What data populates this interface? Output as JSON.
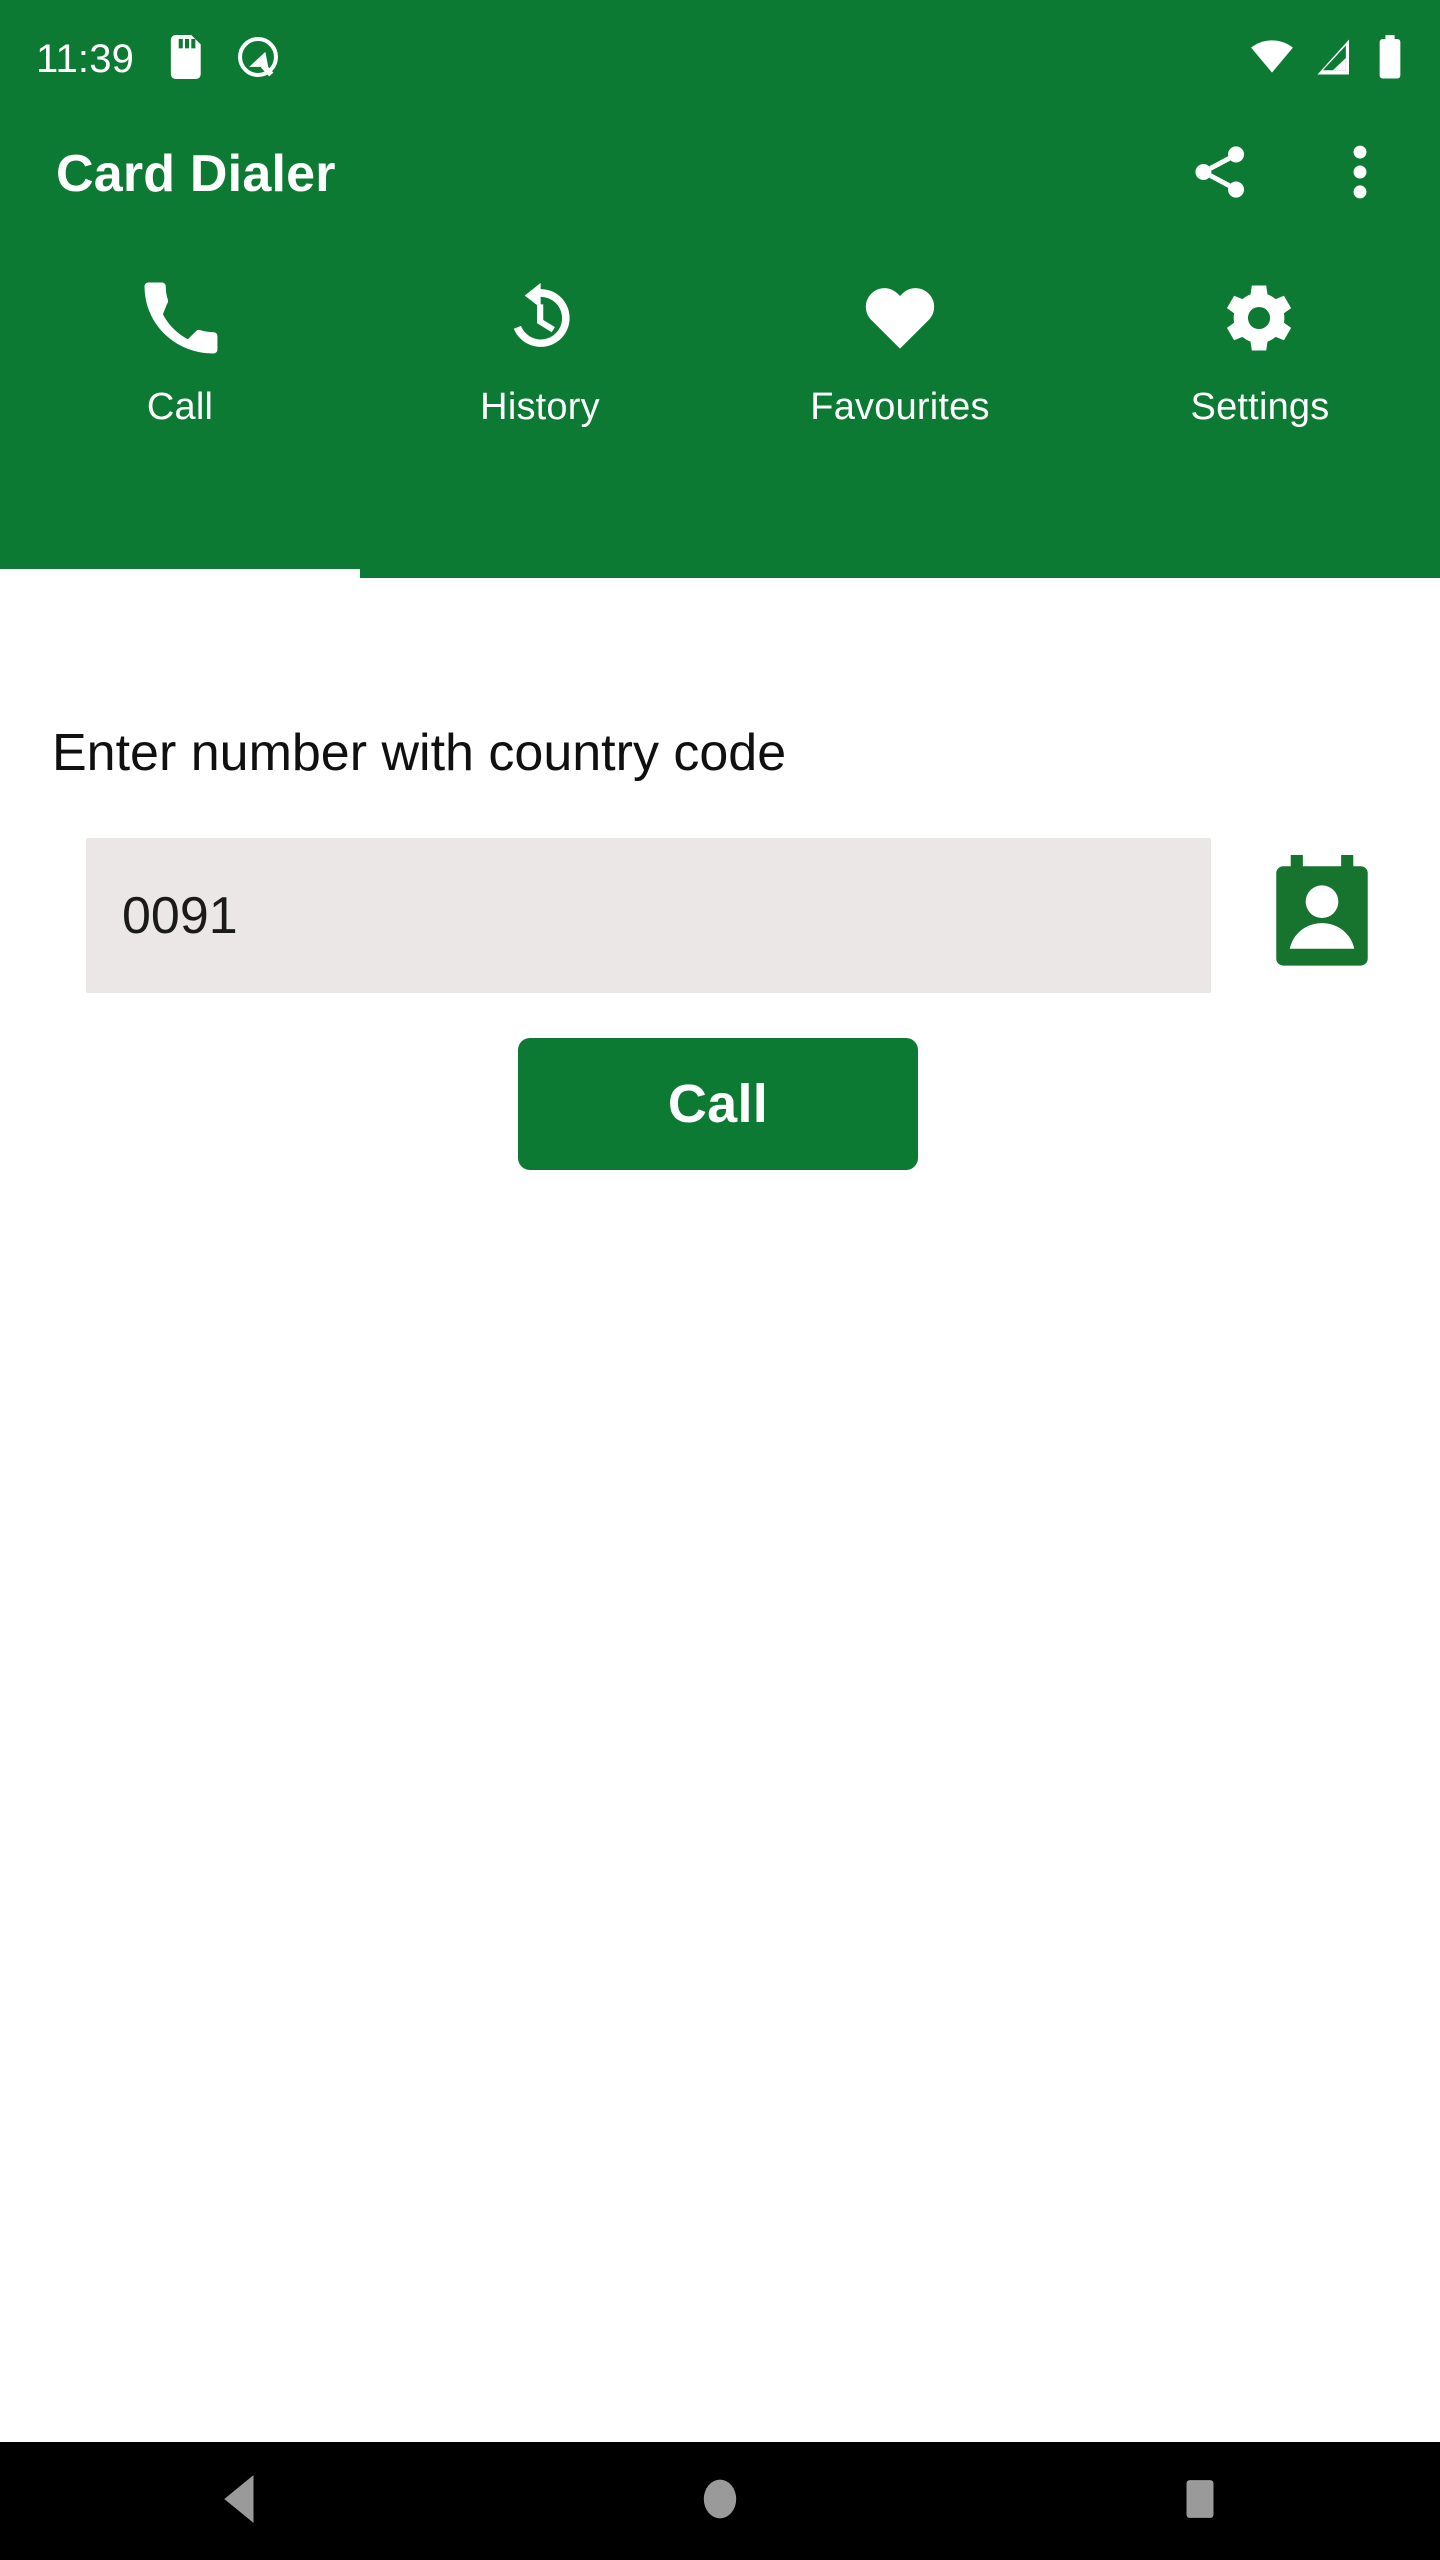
{
  "status_bar": {
    "time": "11:39",
    "left_icons": [
      "sd-card-icon",
      "android-q-icon"
    ],
    "right_icons": [
      "wifi-icon",
      "cellular-signal-icon",
      "battery-icon"
    ],
    "background_color": "#0C7A33",
    "foreground_color": "#FFFFFF"
  },
  "app_bar": {
    "title": "Card Dialer",
    "actions": [
      {
        "name": "share-icon",
        "label": "Share"
      },
      {
        "name": "overflow-menu-icon",
        "label": "More options"
      }
    ]
  },
  "tabs": {
    "active_index": 0,
    "items": [
      {
        "label": "Call",
        "icon": "phone-icon"
      },
      {
        "label": "History",
        "icon": "history-icon"
      },
      {
        "label": "Favourites",
        "icon": "heart-icon"
      },
      {
        "label": "Settings",
        "icon": "gear-icon"
      }
    ]
  },
  "main": {
    "field_label": "Enter number with country code",
    "number_input": {
      "value": "0091",
      "placeholder": ""
    },
    "contacts_button": {
      "icon": "contacts-card-icon",
      "label": "Pick contact"
    },
    "call_button": {
      "label": "Call"
    }
  },
  "nav_bar": {
    "buttons": [
      {
        "name": "back-button",
        "label": "Back"
      },
      {
        "name": "home-button",
        "label": "Home"
      },
      {
        "name": "recents-button",
        "label": "Recents"
      }
    ]
  },
  "colors": {
    "primary_green": "#0C7A33",
    "input_background": "#EBE7E6",
    "page_background": "#FFFFFF",
    "nav_background": "#000000",
    "nav_icon": "#9A9A9A"
  }
}
